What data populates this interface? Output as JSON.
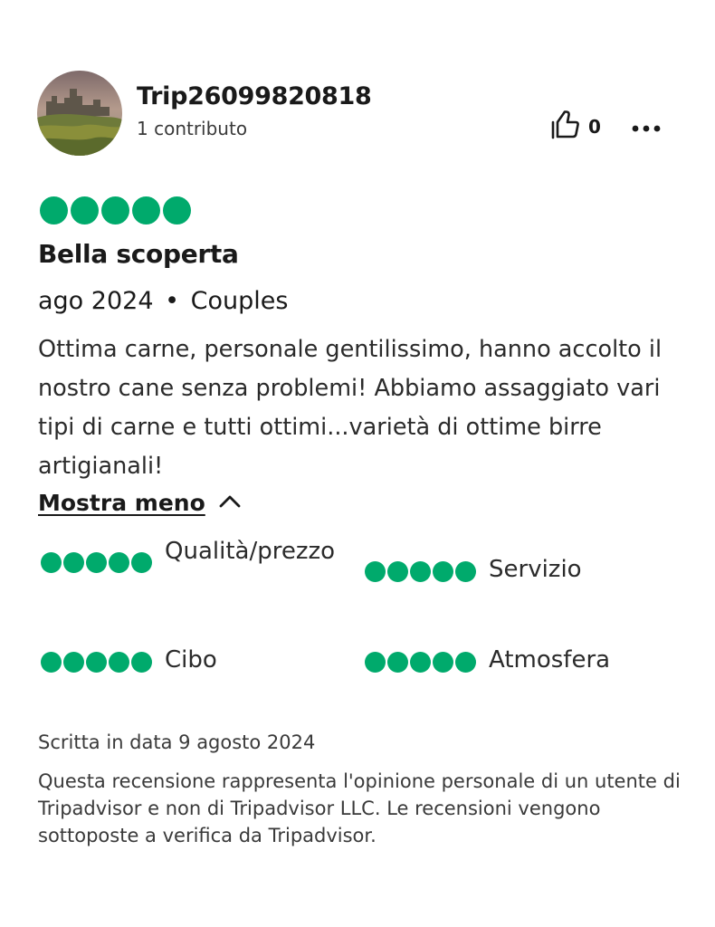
{
  "reviewer": {
    "username": "Trip26099820818",
    "contributions": "1 contributo",
    "avatar_icon": "castle-photo-avatar"
  },
  "actions": {
    "like_icon": "thumbs-up-icon",
    "like_count": "0",
    "more_icon": "more-horizontal-icon"
  },
  "review": {
    "rating": 5,
    "rating_max": 5,
    "title": "Bella scoperta",
    "date": "ago 2024",
    "separator": "•",
    "trip_type": "Couples",
    "body": "Ottima carne, personale gentilissimo, hanno accolto il nostro cane senza problemi! Abbiamo assaggiato vari tipi di carne e tutti ottimi...varietà di ottime birre artigianali!",
    "toggle_label": "Mostra meno",
    "toggle_icon": "chevron-up-icon"
  },
  "sub_ratings": [
    {
      "label": "Qualità/prezzo",
      "rating": 5
    },
    {
      "label": "Servizio",
      "rating": 5
    },
    {
      "label": "Cibo",
      "rating": 5
    },
    {
      "label": "Atmosfera",
      "rating": 5
    }
  ],
  "footer": {
    "written_date": "Scritta in data 9 agosto 2024",
    "disclaimer": "Questa recensione rappresenta l'opinione personale di un utente di Tripadvisor e non di Tripadvisor LLC. Le recensioni vengono sottoposte a verifica da Tripadvisor."
  },
  "colors": {
    "bubble_green": "#00aa6c",
    "text_primary": "#1a1a1a",
    "text_secondary": "#3a3a3a"
  }
}
